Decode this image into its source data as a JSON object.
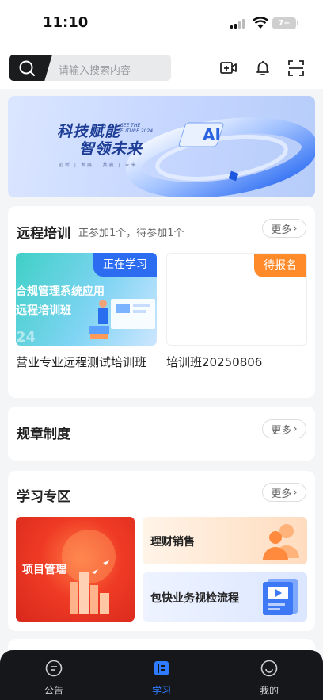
{
  "status": {
    "time": "11:10",
    "battery": "7+"
  },
  "search": {
    "placeholder": "请输入搜索内容"
  },
  "header_icons": [
    "video-call-icon",
    "bell-icon",
    "scan-icon"
  ],
  "banner": {
    "title_line1": "科技赋能",
    "title_line2": "智领未来",
    "en_line1": "SEE THE",
    "en_line2": "FUTURE 2024",
    "tags": "创新 | 发展 | 共赢 | 未来"
  },
  "remote_training": {
    "title": "远程培训",
    "summary": "正参加1个，待参加1个",
    "more": "更多",
    "courses": [
      {
        "badge": "正在学习",
        "cover_line1": "合规管理系统应用",
        "cover_line2": "远程培训班",
        "cover_year": "24",
        "name": "营业专业远程测试培训班"
      },
      {
        "badge": "待报名",
        "name": "培训班20250806"
      }
    ]
  },
  "regulations": {
    "title": "规章制度",
    "more": "更多"
  },
  "study_zone": {
    "title": "学习专区",
    "more": "更多",
    "items": [
      {
        "label": "项目管理"
      },
      {
        "label": "理财销售"
      },
      {
        "label": "包快业务视检流程"
      }
    ]
  },
  "tabbar": {
    "tabs": [
      {
        "label": "公告",
        "icon": "announcement-icon"
      },
      {
        "label": "学习",
        "icon": "study-icon"
      },
      {
        "label": "我的",
        "icon": "profile-icon"
      }
    ],
    "active_tab": "学习",
    "active_color": "#2f7bff"
  }
}
